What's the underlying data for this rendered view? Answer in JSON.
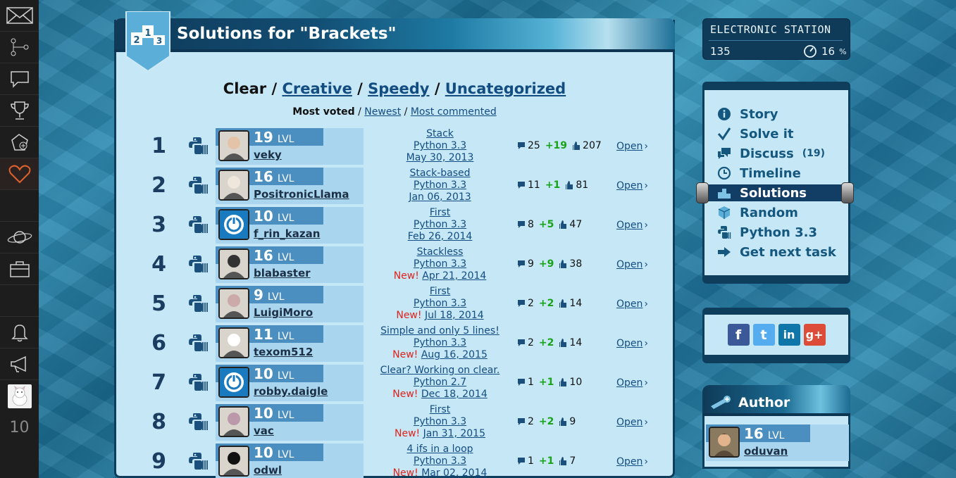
{
  "sidebar": {
    "icons": [
      "envelope-logo-icon",
      "tree-icon",
      "chat-icon",
      "trophy-icon",
      "add-mission-icon",
      "heart-icon",
      "planet-icon",
      "briefcase-icon",
      "bell-icon",
      "megaphone-icon"
    ],
    "user_level": "10"
  },
  "page": {
    "title": "Solutions for \"Brackets\"",
    "badge": {
      "first": "1",
      "second": "2",
      "third": "3"
    }
  },
  "categories": {
    "active": "Clear",
    "creative": "Creative",
    "speedy": "Speedy",
    "uncategorized": "Uncategorized",
    "separator": "/"
  },
  "sorting": {
    "most_voted": "Most voted",
    "newest": "Newest",
    "most_commented": "Most commented"
  },
  "solutions": [
    {
      "rank": "1",
      "level": "19",
      "lvl": "LVL",
      "user": "veky",
      "title": "Stack",
      "lang": "Python 3.3",
      "new": "",
      "date": "May 30, 2013",
      "comments": "25",
      "votes": "+19",
      "views": "207",
      "open": "Open"
    },
    {
      "rank": "2",
      "level": "16",
      "lvl": "LVL",
      "user": "PositronicLlama",
      "title": "Stack-based",
      "lang": "Python 3.3",
      "new": "",
      "date": "Jan 06, 2013",
      "comments": "11",
      "votes": "+1",
      "views": "81",
      "open": "Open"
    },
    {
      "rank": "3",
      "level": "10",
      "lvl": "LVL",
      "user": "f_rin_kazan",
      "title": "First",
      "lang": "Python 3.3",
      "new": "",
      "date": "Feb 26, 2014",
      "comments": "8",
      "votes": "+5",
      "views": "47",
      "open": "Open"
    },
    {
      "rank": "4",
      "level": "16",
      "lvl": "LVL",
      "user": "blabaster",
      "title": "Stackless",
      "lang": "Python 3.3",
      "new": "New!",
      "date": "Apr 21, 2014",
      "comments": "9",
      "votes": "+9",
      "views": "38",
      "open": "Open"
    },
    {
      "rank": "5",
      "level": "9",
      "lvl": "LVL",
      "user": "LuigiMoro",
      "title": "First",
      "lang": "Python 3.3",
      "new": "New!",
      "date": "Jul 18, 2014",
      "comments": "2",
      "votes": "+2",
      "views": "14",
      "open": "Open"
    },
    {
      "rank": "6",
      "level": "11",
      "lvl": "LVL",
      "user": "texom512",
      "title": "Simple and only 5 lines!",
      "lang": "Python 3.3",
      "new": "New!",
      "date": "Aug 16, 2015",
      "comments": "2",
      "votes": "+2",
      "views": "14",
      "open": "Open"
    },
    {
      "rank": "7",
      "level": "10",
      "lvl": "LVL",
      "user": "robby.daigle",
      "title": "Clear? Working on clear.",
      "lang": "Python 2.7",
      "new": "New!",
      "date": "Dec 18, 2014",
      "comments": "1",
      "votes": "+1",
      "views": "10",
      "open": "Open"
    },
    {
      "rank": "8",
      "level": "10",
      "lvl": "LVL",
      "user": "vac",
      "title": "First",
      "lang": "Python 3.3",
      "new": "New!",
      "date": "Jan 31, 2015",
      "comments": "2",
      "votes": "+2",
      "views": "9",
      "open": "Open"
    },
    {
      "rank": "9",
      "level": "10",
      "lvl": "LVL",
      "user": "odwl",
      "title": "4 ifs in a loop",
      "lang": "Python 3.3",
      "new": "New!",
      "date": "Mar 02, 2014",
      "comments": "1",
      "votes": "+1",
      "views": "7",
      "open": "Open"
    }
  ],
  "station": {
    "name": "ELECTRONIC STATION",
    "count": "135",
    "percent": "16",
    "percent_sign": "%"
  },
  "menu": [
    {
      "label": "Story",
      "extra": "",
      "icon": "info-icon"
    },
    {
      "label": "Solve it",
      "extra": "",
      "icon": "checkmark-icon"
    },
    {
      "label": "Discuss",
      "extra": "(19)",
      "icon": "discuss-icon"
    },
    {
      "label": "Timeline",
      "extra": "",
      "icon": "clock-icon"
    },
    {
      "label": "Solutions",
      "extra": "",
      "icon": "podium-icon"
    },
    {
      "label": "Random",
      "extra": "",
      "icon": "cube-icon"
    },
    {
      "label": "Python 3.3",
      "extra": "",
      "icon": "python-icon"
    },
    {
      "label": "Get next task",
      "extra": "",
      "icon": "next-arrow-icon"
    }
  ],
  "social": {
    "facebook": "f",
    "twitter": "t",
    "linkedin": "in",
    "googleplus": "g+"
  },
  "author": {
    "heading": "Author",
    "level": "16",
    "lvl": "LVL",
    "user": "oduvan"
  },
  "colors": {
    "accent_dark": "#0f3d5c",
    "panel_bg": "#c6e7f6",
    "link": "#124c80",
    "positive": "#18a318",
    "new_badge": "#e0231b"
  }
}
